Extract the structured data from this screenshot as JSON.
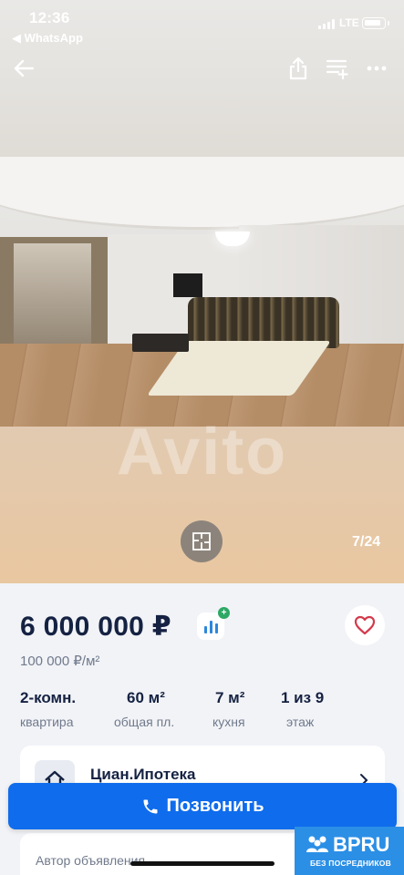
{
  "status_bar": {
    "time": "12:36",
    "back_app": "◀ WhatsApp",
    "network": "LTE"
  },
  "gallery": {
    "counter": "7/24",
    "watermark": "Avito"
  },
  "listing": {
    "price": "6 000 000 ₽",
    "price_per_m2": "100 000 ₽/м²",
    "specs": [
      {
        "value": "2-комн.",
        "label": "квартира"
      },
      {
        "value": "60 м²",
        "label": "общая пл."
      },
      {
        "value": "7 м²",
        "label": "кухня"
      },
      {
        "value": "1 из 9",
        "label": "этаж"
      }
    ]
  },
  "mortgage": {
    "name": "Циан.Ипотека"
  },
  "author": {
    "label": "Автор объявления"
  },
  "actions": {
    "call_label": "Позвонить"
  },
  "badge": {
    "brand": "BPRU",
    "subtitle": "БЕЗ ПОСРЕДНИКОВ"
  },
  "colors": {
    "accent": "#0f6cec",
    "price_text": "#152242",
    "muted_text": "#707a8c",
    "badge": "#2b8fe6"
  }
}
